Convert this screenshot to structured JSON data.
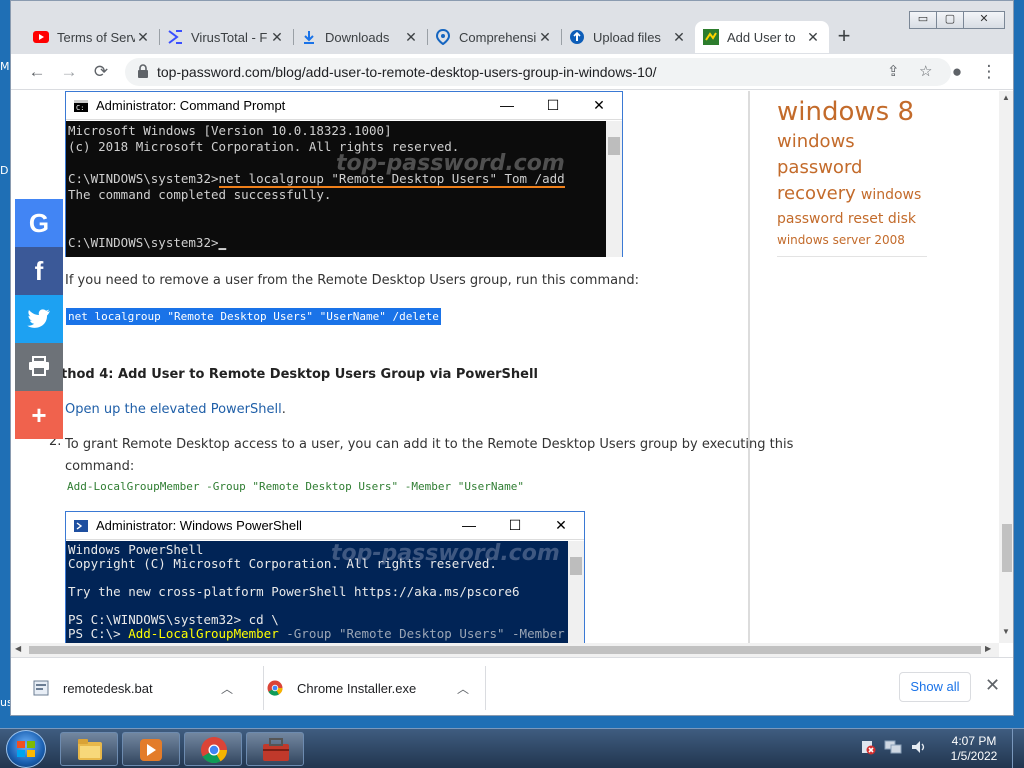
{
  "desktop": {
    "edge_labels": [
      "M",
      "D",
      "us"
    ]
  },
  "window_controls": {
    "minimize": "▭",
    "maximize": "▢",
    "close": "✕"
  },
  "tabs": [
    {
      "label": "Terms of Serv",
      "icon": "youtube-icon"
    },
    {
      "label": "VirusTotal - F",
      "icon": "virustotal-icon"
    },
    {
      "label": "Downloads",
      "icon": "download-icon"
    },
    {
      "label": "Comprehensi",
      "icon": "location-pin-icon"
    },
    {
      "label": "Upload files",
      "icon": "upload-icon"
    },
    {
      "label": "Add User to",
      "icon": "site-favicon",
      "active": true
    }
  ],
  "new_tab": "+",
  "toolbar": {
    "back": "←",
    "forward": "→",
    "reload": "⟳",
    "url": "top-password.com/blog/add-user-to-remote-desktop-users-group-in-windows-10/",
    "share": "⇪",
    "bookmark": "☆",
    "profile": "●",
    "menu": "⋮"
  },
  "sidebar": {
    "tags": [
      {
        "text": "windows 8",
        "size": 26
      },
      {
        "text": "windows",
        "size": 18
      },
      {
        "text": "password",
        "size": 18
      },
      {
        "text": "recovery",
        "size": 18
      },
      {
        "text": "windows",
        "size": 14
      },
      {
        "text": "password reset disk",
        "size": 14
      },
      {
        "text": "windows server 2008",
        "size": 12
      }
    ]
  },
  "cmd_window": {
    "title": "Administrator: Command Prompt",
    "line1": "Microsoft Windows [Version 10.0.18323.1000]",
    "line2": "(c) 2018 Microsoft Corporation. All rights reserved.",
    "prompt1": "C:\\WINDOWS\\system32>",
    "command": "net localgroup \"Remote Desktop Users\" Tom /add",
    "result": "The command completed successfully.",
    "prompt2": "C:\\WINDOWS\\system32>",
    "watermark": "top-password.com"
  },
  "content": {
    "remove_text": "If you need to remove a user from the Remote Desktop Users group, run this command:",
    "remove_cmd": "net localgroup \"Remote Desktop Users\" \"UserName\" /delete",
    "method_heading": "thod 4: Add User to Remote Desktop Users Group via PowerShell",
    "step1_link": "Open up the elevated PowerShell",
    "step1_dot": ".",
    "step2_num": "2.",
    "step2_line1": "To grant Remote Desktop access to a user, you can add it to the Remote Desktop Users group by executing this",
    "step2_line2": "command:",
    "ps_cmd": "Add-LocalGroupMember -Group \"Remote Desktop Users\" -Member \"UserName\""
  },
  "ps_window": {
    "title": "Administrator: Windows PowerShell",
    "line1": "Windows PowerShell",
    "line2": "Copyright (C) Microsoft Corporation. All rights reserved.",
    "line3": "Try the new cross-platform PowerShell https://aka.ms/pscore6",
    "line4": "PS C:\\WINDOWS\\system32> cd \\",
    "prompt": "PS C:\\> ",
    "cmdlet": "Add-LocalGroupMember",
    "args": " -Group \"Remote Desktop Users\" -Member Tom",
    "watermark": "top-password.com"
  },
  "share_buttons": [
    {
      "name": "google-share-button",
      "glyph": "G",
      "color": "#4285f4"
    },
    {
      "name": "facebook-share-button",
      "glyph": "f",
      "color": "#3b5998"
    },
    {
      "name": "twitter-share-button",
      "glyph": "🐦",
      "color": "#1da1f2"
    },
    {
      "name": "print-button",
      "glyph": "⎙",
      "color": "#6d7278"
    },
    {
      "name": "more-share-button",
      "glyph": "+",
      "color": "#f0624d"
    }
  ],
  "downloads": {
    "items": [
      {
        "name": "remotedesk.bat"
      },
      {
        "name": "Chrome Installer.exe"
      }
    ],
    "show_all": "Show all",
    "close": "✕"
  },
  "taskbar": {
    "time": "4:07 PM",
    "date": "1/5/2022"
  }
}
